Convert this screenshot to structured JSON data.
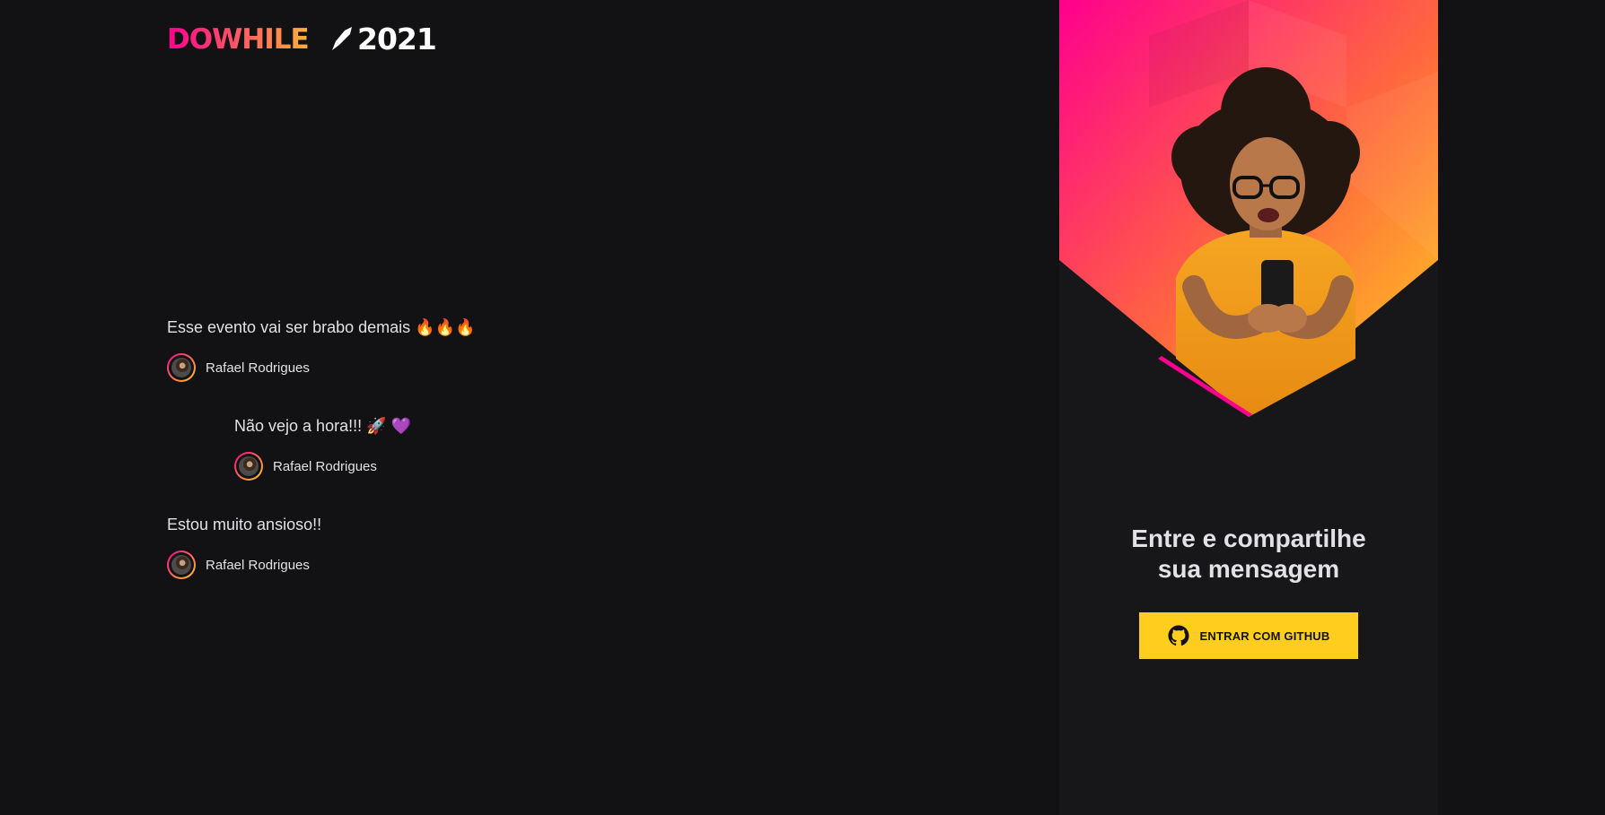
{
  "logo": {
    "do_text": "DO",
    "while_text": "WHILE",
    "year_text": "2021",
    "icon": "rocket-icon",
    "colors": {
      "pink": "#ff008e",
      "orange": "#ff9f43",
      "white": "#ffffff"
    }
  },
  "messages": [
    {
      "text": "Esse evento vai ser brabo demais 🔥🔥🔥",
      "user": {
        "name": "Rafael Rodrigues",
        "avatar": "user-avatar"
      }
    },
    {
      "text": "Não vejo a hora!!! 🚀 💜",
      "user": {
        "name": "Rafael Rodrigues",
        "avatar": "user-avatar"
      }
    },
    {
      "text": "Estou muito ansioso!!",
      "user": {
        "name": "Rafael Rodrigues",
        "avatar": "user-avatar"
      }
    }
  ],
  "login": {
    "title_line1": "Entre e compartilhe",
    "title_line2": "sua mensagem",
    "button_label": "ENTRAR COM GITHUB",
    "button_icon": "github-icon",
    "button_color": "#ffcd1e",
    "hero_gradient": [
      "#ff008e",
      "#ff6a3d",
      "#ffcd1e"
    ]
  }
}
